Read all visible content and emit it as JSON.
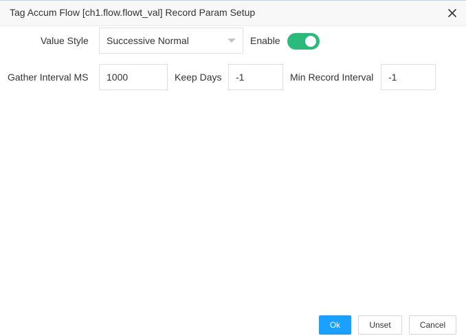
{
  "dialog": {
    "title": "Tag Accum Flow [ch1.flow.flowt_val] Record Param Setup",
    "close_icon": "close-icon"
  },
  "form": {
    "value_style": {
      "label": "Value Style",
      "selected": "Successive Normal"
    },
    "enable": {
      "label": "Enable",
      "checked": true,
      "on_color": "#2aba7a"
    },
    "gather_interval": {
      "label": "Gather Interval MS",
      "value": "1000"
    },
    "keep_days": {
      "label": "Keep Days",
      "value": "-1"
    },
    "min_record_interval": {
      "label": "Min Record Interval",
      "value": "-1"
    }
  },
  "footer": {
    "ok_label": "Ok",
    "unset_label": "Unset",
    "cancel_label": "Cancel",
    "primary_color": "#1aa0ff"
  }
}
